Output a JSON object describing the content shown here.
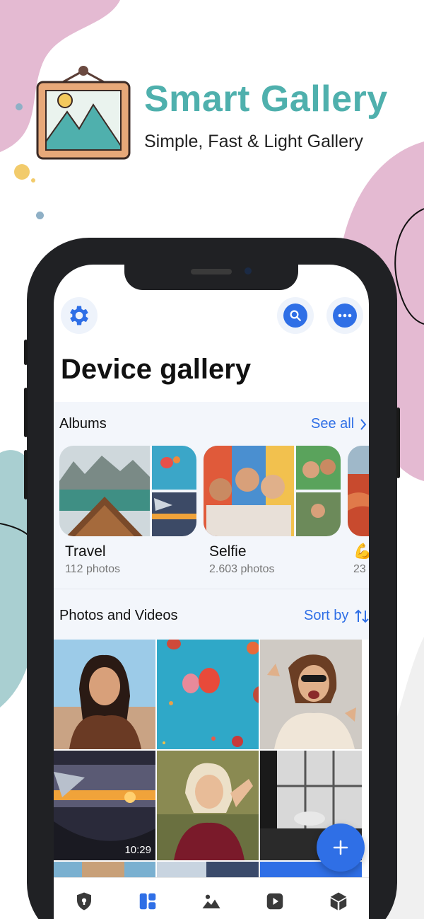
{
  "header": {
    "title": "Smart Gallery",
    "subtitle": "Simple, Fast & Light Gallery"
  },
  "colors": {
    "accent": "#2f6fe6",
    "brand_teal": "#4fb0ad",
    "blob_pink": "#e4bad2",
    "blob_teal": "#a9cfd1"
  },
  "screen": {
    "top_bar": {
      "settings_icon": "gear-icon",
      "search_icon": "search-icon",
      "more_icon": "more-icon"
    },
    "page_title": "Device gallery",
    "albums": {
      "title": "Albums",
      "see_all": "See all",
      "items": [
        {
          "name": "Travel",
          "count": "112 photos"
        },
        {
          "name": "Selfie",
          "count": "2.603 photos"
        },
        {
          "name": "💪",
          "count": "23"
        }
      ]
    },
    "photos": {
      "title": "Photos and Videos",
      "sort_label": "Sort by",
      "tiles": [
        {
          "label": "portrait-woman-photo"
        },
        {
          "label": "hot-air-balloons-photo"
        },
        {
          "label": "excited-woman-photo"
        },
        {
          "label": "airplane-sunset-video",
          "duration": "10:29"
        },
        {
          "label": "blonde-woman-photo"
        },
        {
          "label": "interior-chair-photo"
        }
      ]
    },
    "fab_icon": "plus-icon",
    "bottom_nav": [
      {
        "icon": "shield-icon"
      },
      {
        "icon": "grid-icon"
      },
      {
        "icon": "image-icon"
      },
      {
        "icon": "play-icon"
      },
      {
        "icon": "cube-icon"
      }
    ]
  }
}
